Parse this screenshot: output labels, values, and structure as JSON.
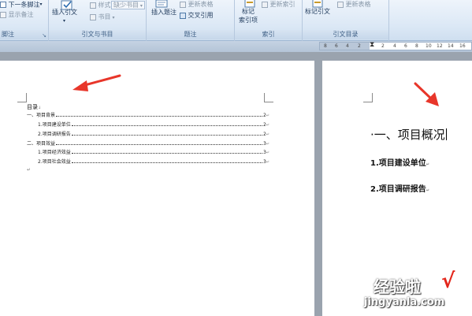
{
  "ribbon": {
    "footnotes": {
      "next_footnote": "下一条脚注",
      "show_notes": "显示备注",
      "group_label": "脚注"
    },
    "citations": {
      "insert_citation": "插入引文",
      "style_label": "样式:",
      "style_value": "缺少书目",
      "bibliography": "书目",
      "group_label": "引文与书目"
    },
    "captions": {
      "insert_caption": "插入题注",
      "update_table": "更新表格",
      "cross_reference": "交叉引用",
      "group_label": "题注"
    },
    "index": {
      "mark_entry_line1": "标记",
      "mark_entry_line2": "索引项",
      "update_index": "更新索引",
      "group_label": "索引"
    },
    "table_of_authorities": {
      "mark_citation": "标记引文",
      "update_table": "更新表格",
      "group_label": "引文目录"
    }
  },
  "ruler": {
    "ticks": [
      "8",
      "6",
      "4",
      "2",
      "2",
      "4",
      "6",
      "8",
      "10",
      "12",
      "14",
      "16"
    ]
  },
  "left_page": {
    "toc_title": "目录",
    "toc_title_mark": "↓",
    "entries": [
      {
        "text": "一、项目背景",
        "page": "2",
        "mark": "↵"
      },
      {
        "text": "1.项目建设单位",
        "page": "2",
        "mark": "↵"
      },
      {
        "text": "2.项目调研报告",
        "page": "2",
        "mark": "↵"
      },
      {
        "text": "二、项目效益",
        "page": "3",
        "mark": "↵"
      },
      {
        "text": "1.项目经济效益",
        "page": "3",
        "mark": "↵"
      },
      {
        "text": "2.项目社会效益",
        "page": "3",
        "mark": "↵"
      }
    ],
    "end_mark": "↵"
  },
  "right_page": {
    "heading": "·一、项目概况",
    "sub1": "1.项目建设单位",
    "sub2": "2.项目调研报告",
    "para_mark": "↵"
  },
  "watermark": {
    "line1": "经验啦",
    "check": "√",
    "line2": "jingyanla.com"
  },
  "colors": {
    "arrow": "#e8362a",
    "ribbon_text": "#1e395b",
    "workspace": "#9aa3ae"
  }
}
